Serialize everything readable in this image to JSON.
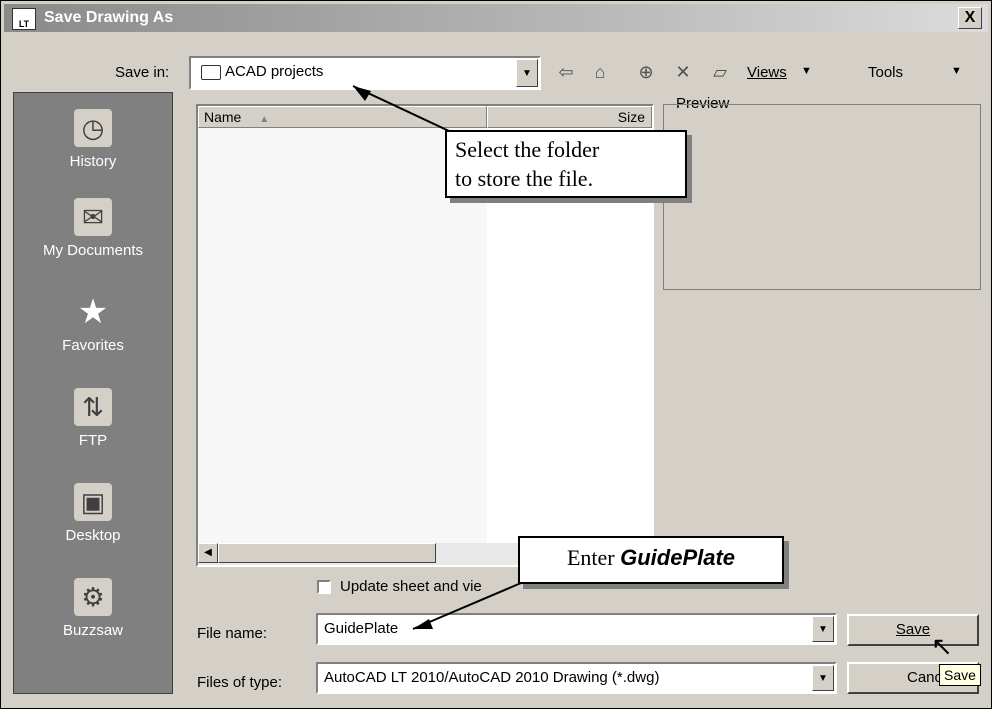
{
  "window": {
    "title": "Save Drawing As",
    "icon": "autocad-lt-icon",
    "close_label": "X"
  },
  "toolbar": {
    "save_in_label": "Save in:",
    "save_in_value": "ACAD projects",
    "views_label": "Views",
    "tools_label": "Tools",
    "icons": [
      "back-icon",
      "up-folder-icon",
      "search-web-icon",
      "delete-icon",
      "new-folder-icon"
    ]
  },
  "places": [
    {
      "label": "History",
      "icon": "history-icon"
    },
    {
      "label": "My Documents",
      "icon": "my-documents-icon"
    },
    {
      "label": "Favorites",
      "icon": "favorites-star-icon"
    },
    {
      "label": "FTP",
      "icon": "ftp-icon"
    },
    {
      "label": "Desktop",
      "icon": "desktop-icon"
    },
    {
      "label": "Buzzsaw",
      "icon": "buzzsaw-icon"
    }
  ],
  "filelist": {
    "columns": [
      "Name",
      "Size"
    ]
  },
  "preview": {
    "label": "Preview"
  },
  "options": {
    "update_sheet_label": "Update sheet and vie"
  },
  "filename": {
    "label": "File name:",
    "value": "GuidePlate"
  },
  "filetype": {
    "label": "Files of type:",
    "value": "AutoCAD LT 2010/AutoCAD 2010 Drawing (*.dwg)"
  },
  "buttons": {
    "save": "Save",
    "cancel": "Cance"
  },
  "tooltip": {
    "text": "Save"
  },
  "callouts": {
    "folder_line1": "Select the folder",
    "folder_line2": "to store the file.",
    "enter_prefix": "Enter",
    "enter_value": "GuidePlate"
  }
}
